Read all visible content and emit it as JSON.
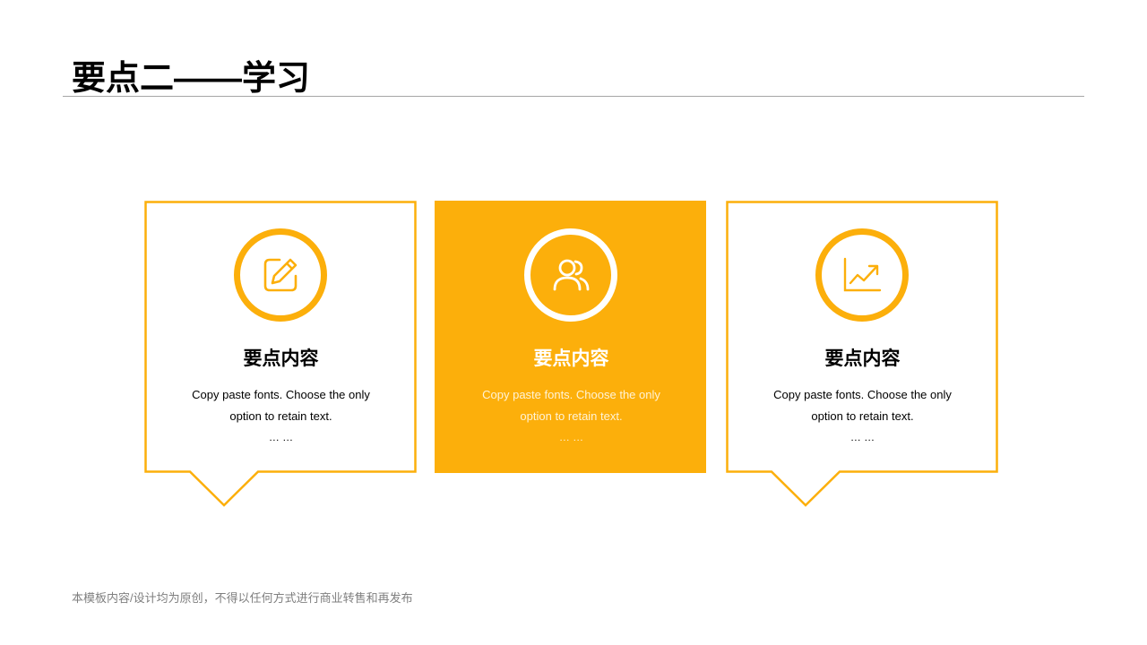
{
  "slide": {
    "title": "要点二——学习",
    "footer": "本模板内容/设计均为原创，不得以任何方式进行商业转售和再发布"
  },
  "colors": {
    "accent": "#fcaf0b",
    "divider": "#a6a6a6",
    "footer_text": "#7f7f7f"
  },
  "cards": [
    {
      "icon": "edit-icon",
      "title": "要点内容",
      "text": "Copy paste fonts. Choose the only option to retain text.",
      "more": "… …",
      "style": "outlined"
    },
    {
      "icon": "users-icon",
      "title": "要点内容",
      "text": "Copy paste fonts. Choose the only option to retain text.",
      "more": "… …",
      "style": "filled"
    },
    {
      "icon": "chart-icon",
      "title": "要点内容",
      "text": "Copy paste fonts. Choose the only option to retain text.",
      "more": "… …",
      "style": "outlined"
    }
  ]
}
